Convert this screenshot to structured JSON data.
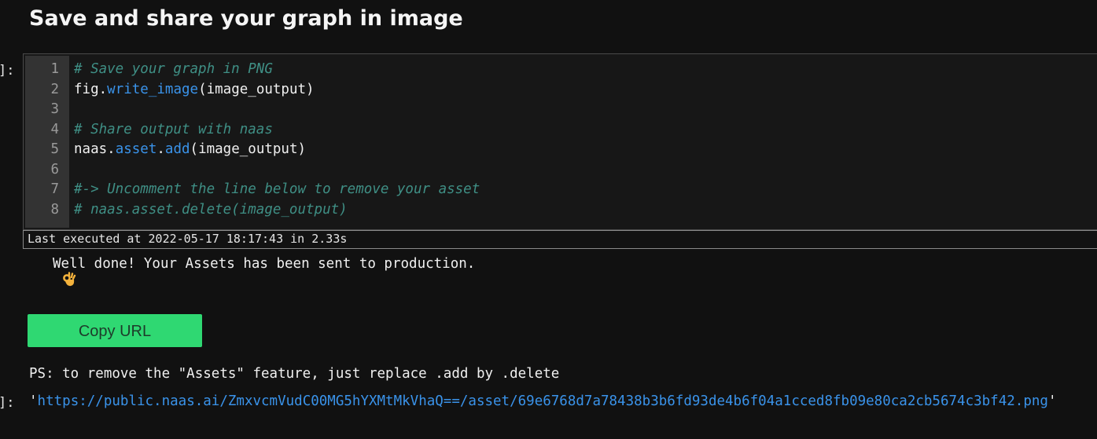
{
  "heading": "Save and share your graph in image",
  "cell": {
    "prompt": "]:",
    "lines": [
      {
        "n": "1",
        "parts": [
          {
            "t": "# Save your graph in PNG",
            "c": "comment"
          }
        ]
      },
      {
        "n": "2",
        "parts": [
          {
            "t": "fig.",
            "c": ""
          },
          {
            "t": "write_image",
            "c": "call"
          },
          {
            "t": "(image_output)",
            "c": ""
          }
        ]
      },
      {
        "n": "3",
        "parts": []
      },
      {
        "n": "4",
        "parts": [
          {
            "t": "# Share output with naas",
            "c": "comment"
          }
        ]
      },
      {
        "n": "5",
        "parts": [
          {
            "t": "naas.",
            "c": ""
          },
          {
            "t": "asset",
            "c": "call"
          },
          {
            "t": ".",
            "c": ""
          },
          {
            "t": "add",
            "c": "call"
          },
          {
            "t": "(image_output)",
            "c": ""
          }
        ]
      },
      {
        "n": "6",
        "parts": []
      },
      {
        "n": "7",
        "parts": [
          {
            "t": "#-> Uncomment the line below to remove your asset",
            "c": "comment"
          }
        ]
      },
      {
        "n": "8",
        "parts": [
          {
            "t": "# naas.asset.delete(image_output)",
            "c": "comment"
          }
        ]
      }
    ],
    "last_executed": "Last executed at 2022-05-17 18:17:43 in 2.33s"
  },
  "output": {
    "ok_icon": "ok-hand-icon",
    "message": "Well done! Your Assets has been sent to production.",
    "copy_button": "Copy URL",
    "ps_text": "PS: to remove the \"Assets\" feature, just replace .add by .delete",
    "url_prompt": "]:",
    "quote_open": "'",
    "url": "https://public.naas.ai/ZmxvcmVudC00MG5hYXMtMkVhaQ==/asset/69e6768d7a78438b3b6fd93de4b6f04a1cced8fb09e80ca2cb5674c3bf42.png",
    "quote_close": "'"
  },
  "colors": {
    "background": "#111111",
    "comment": "#3f8f85",
    "call": "#3a93ea",
    "button": "#2fd872"
  }
}
